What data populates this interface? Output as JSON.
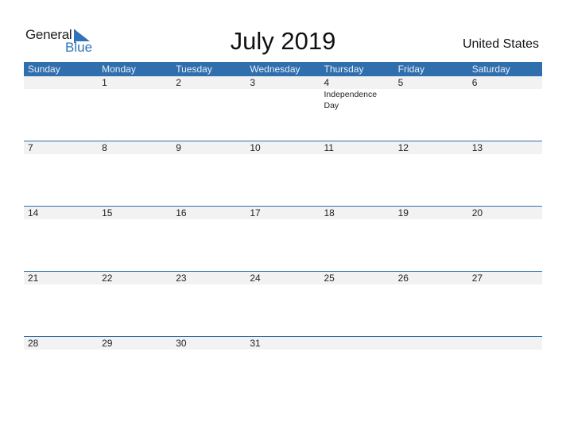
{
  "logo": {
    "general": "General",
    "blue": "Blue"
  },
  "title": "July 2019",
  "country": "United States",
  "weekdays": [
    "Sunday",
    "Monday",
    "Tuesday",
    "Wednesday",
    "Thursday",
    "Friday",
    "Saturday"
  ],
  "weeks": [
    {
      "days": [
        "",
        "1",
        "2",
        "3",
        "4",
        "5",
        "6"
      ],
      "events": [
        "",
        "",
        "",
        "",
        "Independence Day",
        "",
        ""
      ]
    },
    {
      "days": [
        "7",
        "8",
        "9",
        "10",
        "11",
        "12",
        "13"
      ],
      "events": [
        "",
        "",
        "",
        "",
        "",
        "",
        ""
      ]
    },
    {
      "days": [
        "14",
        "15",
        "16",
        "17",
        "18",
        "19",
        "20"
      ],
      "events": [
        "",
        "",
        "",
        "",
        "",
        "",
        ""
      ]
    },
    {
      "days": [
        "21",
        "22",
        "23",
        "24",
        "25",
        "26",
        "27"
      ],
      "events": [
        "",
        "",
        "",
        "",
        "",
        "",
        ""
      ]
    },
    {
      "days": [
        "28",
        "29",
        "30",
        "31",
        "",
        "",
        ""
      ],
      "events": [
        "",
        "",
        "",
        "",
        "",
        "",
        ""
      ]
    }
  ],
  "colors": {
    "accent": "#2f6fae",
    "row_bg": "#f2f2f2"
  }
}
